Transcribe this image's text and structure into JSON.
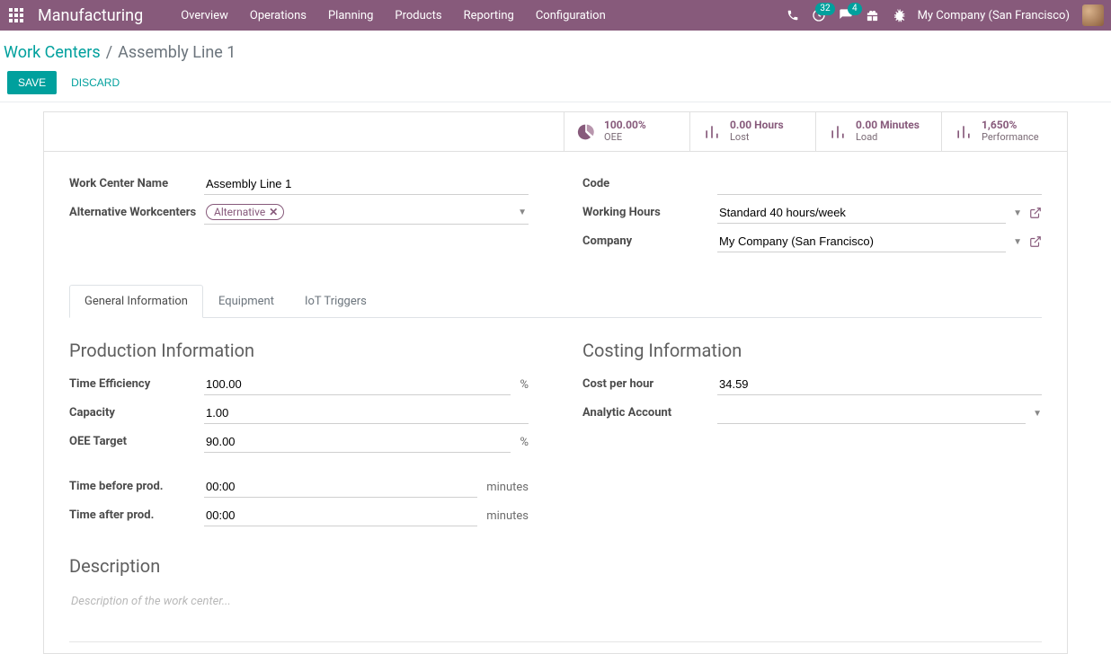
{
  "navbar": {
    "brand": "Manufacturing",
    "menu": [
      "Overview",
      "Operations",
      "Planning",
      "Products",
      "Reporting",
      "Configuration"
    ],
    "activities_badge": "32",
    "discuss_badge": "4",
    "company": "My Company (San Francisco)"
  },
  "breadcrumb": {
    "parent": "Work Centers",
    "current": "Assembly Line 1"
  },
  "actions": {
    "save": "SAVE",
    "discard": "DISCARD"
  },
  "stats": [
    {
      "value": "100.00%",
      "label": "OEE"
    },
    {
      "value": "0.00 Hours",
      "label": "Lost"
    },
    {
      "value": "0.00 Minutes",
      "label": "Load"
    },
    {
      "value": "1,650%",
      "label": "Performance"
    }
  ],
  "fields": {
    "work_center_name_label": "Work Center Name",
    "work_center_name": "Assembly Line 1",
    "alt_workcenters_label": "Alternative Workcenters",
    "alt_workcenters_tag": "Alternative",
    "code_label": "Code",
    "code": "",
    "working_hours_label": "Working Hours",
    "working_hours": "Standard 40 hours/week",
    "company_label": "Company",
    "company": "My Company (San Francisco)"
  },
  "tabs": [
    "General Information",
    "Equipment",
    "IoT Triggers"
  ],
  "production": {
    "heading": "Production Information",
    "time_efficiency_label": "Time Efficiency",
    "time_efficiency": "100.00",
    "time_efficiency_unit": "%",
    "capacity_label": "Capacity",
    "capacity": "1.00",
    "oee_target_label": "OEE Target",
    "oee_target": "90.00",
    "oee_target_unit": "%",
    "time_before_label": "Time before prod.",
    "time_before": "00:00",
    "time_before_unit": "minutes",
    "time_after_label": "Time after prod.",
    "time_after": "00:00",
    "time_after_unit": "minutes"
  },
  "costing": {
    "heading": "Costing Information",
    "cost_per_hour_label": "Cost per hour",
    "cost_per_hour": "34.59",
    "analytic_account_label": "Analytic Account",
    "analytic_account": ""
  },
  "description": {
    "heading": "Description",
    "placeholder": "Description of the work center...",
    "value": ""
  }
}
